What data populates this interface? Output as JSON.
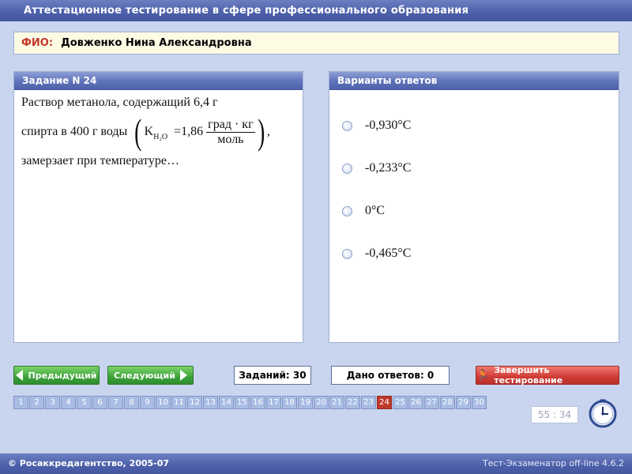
{
  "window": {
    "title": "Аттестационное тестирование в сфере профессионального образования"
  },
  "fio": {
    "label": "ФИО:",
    "value": "Довженко Нина Александровна"
  },
  "task": {
    "header": "Задание N 24",
    "line1": "Раствор метанола, содержащий 6,4 г",
    "line2_prefix": "спирта в 400 г воды",
    "k_symbol": "K",
    "k_sub": "H₂O",
    "k_eq": "=1,86",
    "unit_num": "град · кг",
    "unit_den": "моль",
    "line2_suffix": ",",
    "line3": "замерзает при температуре…"
  },
  "answers": {
    "header": "Варианты ответов",
    "options": [
      "-0,930°C",
      "-0,233°C",
      "0°C",
      "-0,465°C"
    ]
  },
  "nav": {
    "prev_label": "Предыдущий",
    "next_label": "Следующий",
    "total_label": "Заданий: 30",
    "given_label": "Дано ответов: 0",
    "finish_label": "Завершить тестирование",
    "pages": [
      "1",
      "2",
      "3",
      "4",
      "5",
      "6",
      "7",
      "8",
      "9",
      "10",
      "11",
      "12",
      "13",
      "14",
      "15",
      "16",
      "17",
      "18",
      "19",
      "20",
      "21",
      "22",
      "23",
      "24",
      "25",
      "26",
      "27",
      "28",
      "29",
      "30"
    ],
    "current_page": "24",
    "timer": "55 : 34"
  },
  "footer": {
    "copyright": "© Росаккредагентство, 2005-07",
    "version": "Тест-Экзаменатор off-line 4.6.2"
  },
  "colors": {
    "accent": "#4c5fa9",
    "active_page": "#c0392b",
    "finish": "#cf3b35",
    "nav": "#3da33a"
  }
}
